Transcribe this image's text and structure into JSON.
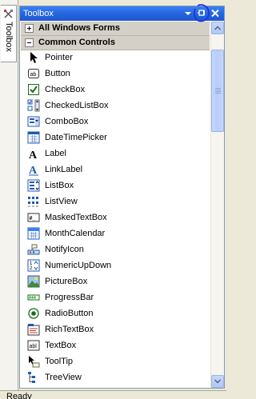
{
  "side_tab": {
    "label": "Toolbox",
    "icon": "toolbox-icon"
  },
  "window": {
    "title": "Toolbox",
    "buttons": {
      "dropdown": "chevron-down-icon",
      "pin": "pin-icon",
      "close": "close-icon"
    }
  },
  "groups": [
    {
      "label": "All Windows Forms",
      "expanded": false
    },
    {
      "label": "Common Controls",
      "expanded": true
    }
  ],
  "items": [
    {
      "label": "Pointer",
      "icon": "pointer-icon"
    },
    {
      "label": "Button",
      "icon": "button-icon"
    },
    {
      "label": "CheckBox",
      "icon": "checkbox-icon"
    },
    {
      "label": "CheckedListBox",
      "icon": "checkedlistbox-icon"
    },
    {
      "label": "ComboBox",
      "icon": "combobox-icon"
    },
    {
      "label": "DateTimePicker",
      "icon": "datetimepicker-icon"
    },
    {
      "label": "Label",
      "icon": "label-icon"
    },
    {
      "label": "LinkLabel",
      "icon": "linklabel-icon"
    },
    {
      "label": "ListBox",
      "icon": "listbox-icon"
    },
    {
      "label": "ListView",
      "icon": "listview-icon"
    },
    {
      "label": "MaskedTextBox",
      "icon": "maskedtextbox-icon"
    },
    {
      "label": "MonthCalendar",
      "icon": "monthcalendar-icon"
    },
    {
      "label": "NotifyIcon",
      "icon": "notifyicon-icon"
    },
    {
      "label": "NumericUpDown",
      "icon": "numericupdown-icon"
    },
    {
      "label": "PictureBox",
      "icon": "picturebox-icon"
    },
    {
      "label": "ProgressBar",
      "icon": "progressbar-icon"
    },
    {
      "label": "RadioButton",
      "icon": "radiobutton-icon"
    },
    {
      "label": "RichTextBox",
      "icon": "richtextbox-icon"
    },
    {
      "label": "TextBox",
      "icon": "textbox-icon"
    },
    {
      "label": "ToolTip",
      "icon": "tooltip-icon"
    },
    {
      "label": "TreeView",
      "icon": "treeview-icon"
    }
  ],
  "status": {
    "text": "Ready"
  },
  "colors": {
    "title_bar": "#2463de",
    "group_header": "#d4d0c8",
    "annotation": "#1f2fd6"
  }
}
